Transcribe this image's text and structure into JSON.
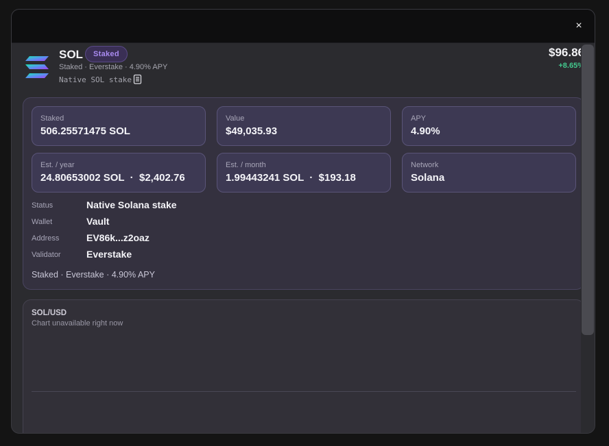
{
  "modal": {
    "close_label": "×"
  },
  "asset": {
    "symbol": "SOL",
    "badge": "Staked",
    "subtitle": "Staked · Everstake · 4.90% APY",
    "type_label": "Native SOL stake",
    "price": "$96.86",
    "change": "+8.65%",
    "change_color": "#43c98e",
    "accent": "#a98bf0"
  },
  "stats": [
    {
      "label": "Staked",
      "value": "506.25571475 SOL"
    },
    {
      "label": "Value",
      "value": "$49,035.93"
    },
    {
      "label": "APY",
      "value": "4.90%"
    },
    {
      "label": "Est. / year",
      "value": "24.80653002 SOL  ·  $2,402.76"
    },
    {
      "label": "Est. / month",
      "value": "1.99443241 SOL  ·  $193.18"
    },
    {
      "label": "Network",
      "value": "Solana"
    }
  ],
  "details": [
    {
      "label": "Status",
      "value": "Native Solana stake"
    },
    {
      "label": "Wallet",
      "value": "Vault"
    },
    {
      "label": "Address",
      "value": "EV86k...z2oaz"
    },
    {
      "label": "Validator",
      "value": "Everstake"
    }
  ],
  "panel_footer": "Staked · Everstake · 4.90% APY",
  "chart": {
    "title": "SOL/USD",
    "subtitle": "Chart unavailable right now"
  }
}
